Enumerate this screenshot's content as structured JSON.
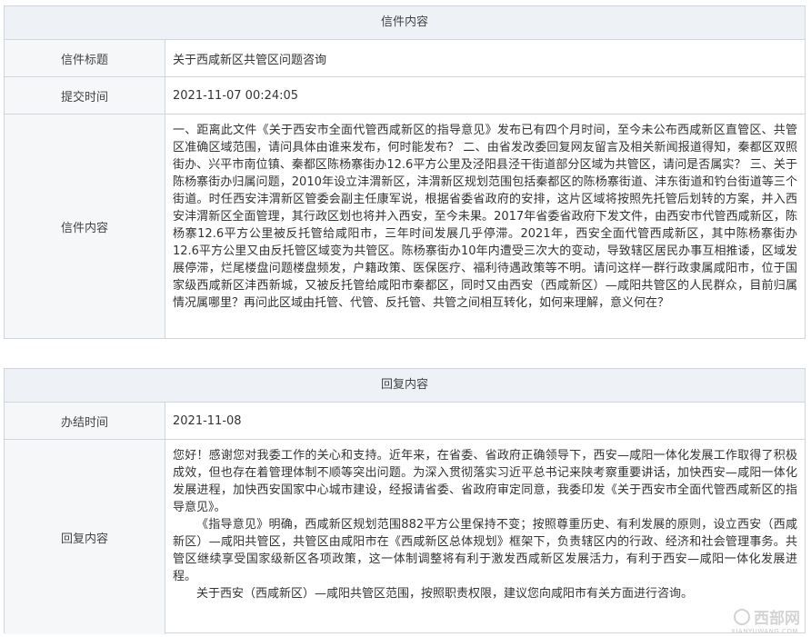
{
  "letter": {
    "header": "信件内容",
    "title_label": "信件标题",
    "title_value": "关于西咸新区共管区问题咨询",
    "time_label": "提交时间",
    "time_value": "2021-11-07 00:24:05",
    "content_label": "信件内容",
    "content_value": "一、距离此文件《关于西安市全面代管西咸新区的指导意见》发布已有四个月时间，至今未公布西咸新区直管区、共管区准确区域范围，请问具体由谁来发布，何时能发布？ 二、由省发改委回复网友留言及相关新闻报道得知，秦都区双照街办、兴平市南位镇、秦都区陈杨寨街办12.6平方公里及泾阳县泾干街道部分区域为共管区，请问是否属实？ 三、关于陈杨寨街办归属问题，2010年设立沣渭新区，沣渭新区规划范围包括秦都区的陈杨寨街道、沣东街道和钓台街道等三个街道。时任西安沣渭新区管委会副主任康军说，根据省委省政府的安排，这片区域将按照先托管后划转的方案，并入西安沣渭新区全面管理，其行政区划也将并入西安，至今未果。2017年省委省政府下发文件，由西安市代管西咸新区，陈杨寨12.6平方公里被反托管给咸阳市，三年时间发展几乎停滞。2021年，西安全面代管西咸新区，其中陈杨寨街办12.6平方公里又由反托管区域变为共管区。陈杨寨街办10年内遭受三次大的变动，导致辖区居民办事互相推诿，区域发展停滞，烂尾楼盘问题楼盘频发，户籍政策、医保医疗、福利待遇政策等不明。请问这样一群行政隶属咸阳市，位于国家级西咸新区沣西新城，又被反托管给咸阳市秦都区，同时又由西安（西咸新区）—咸阳共管区的人民群众，目前归属情况属哪里？再问此区域由托管、代管、反托管、共管之间相互转化，如何来理解，意义何在？"
  },
  "reply": {
    "header": "回复内容",
    "date_label": "办结时间",
    "date_value": "2021-11-08",
    "content_label": "回复内容",
    "para1": "您好！感谢您对我委工作的关心和支持。近年来，在省委、省政府正确领导下，西安—咸阳一体化发展工作取得了积极成效，但也存在着管理体制不顺等突出问题。为深入贯彻落实习近平总书记来陕考察重要讲话，加快西安—咸阳一体化发展进程，加快西安国家中心城市建设，经报请省委、省政府审定同意，我委印发《关于西安市全面代管西咸新区的指导意见》。",
    "para2": "《指导意见》明确，西咸新区规划范围882平方公里保持不变；按照尊重历史、有利发展的原则，设立西安（西咸新区）—咸阳共管区，共管区由咸阳市在《西咸新区总体规划》框架下，负责辖区内的行政、经济和社会管理事务。共管区继续享受国家级新区各项政策，这一体制调整将有利于激发西咸新区发展活力，有利于西安—咸阳一体化发展进程。",
    "para3": "关于西安（西咸新区）—咸阳共管区范围，按照职责权限，建议您向咸阳市有关方面进行咨询。"
  },
  "watermark": {
    "text": "西部网",
    "sub": "XIANYUWANG.COM"
  }
}
